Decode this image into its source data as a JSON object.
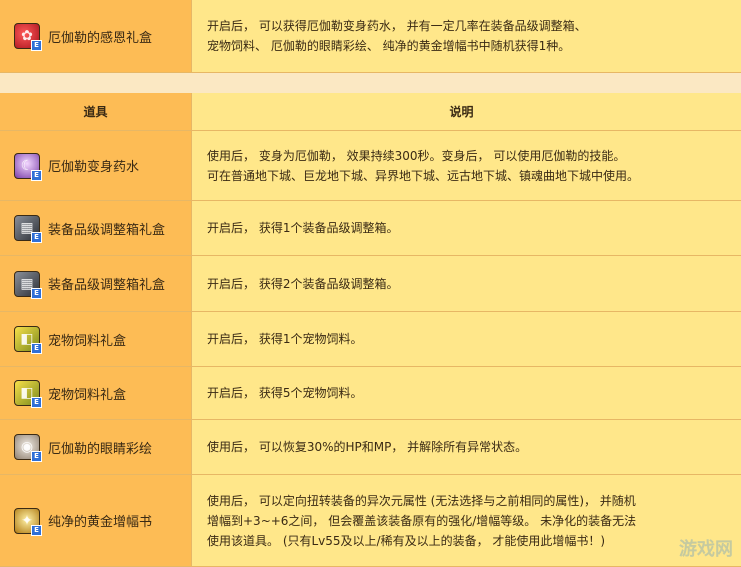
{
  "top_item": {
    "name": "厄伽勒的感恩礼盒",
    "icon": "gift-box-icon",
    "desc": [
      "开启后， 可以获得厄伽勒变身药水， 并有一定几率在装备品级调整箱、",
      "宠物饲料、 厄伽勒的眼睛彩绘、 纯净的黄金增幅书中随机获得1种。"
    ]
  },
  "header": {
    "item_col": "道具",
    "desc_col": "说明"
  },
  "items": [
    {
      "name": "厄伽勒变身药水",
      "icon": "potion-icon",
      "desc": [
        "使用后， 变身为厄伽勒， 效果持续300秒。变身后， 可以使用厄伽勒的技能。",
        "可在普通地下城、巨龙地下城、异界地下城、远古地下城、镇魂曲地下城中使用。"
      ]
    },
    {
      "name": "装备品级调整箱礼盒",
      "icon": "equipment-box-icon",
      "desc": [
        "开启后， 获得1个装备品级调整箱。"
      ]
    },
    {
      "name": "装备品级调整箱礼盒",
      "icon": "equipment-box-icon",
      "desc": [
        "开启后， 获得2个装备品级调整箱。"
      ]
    },
    {
      "name": "宠物饲料礼盒",
      "icon": "pet-feed-icon",
      "desc": [
        "开启后， 获得1个宠物饲料。"
      ]
    },
    {
      "name": "宠物饲料礼盒",
      "icon": "pet-feed-icon",
      "desc": [
        "开启后， 获得5个宠物饲料。"
      ]
    },
    {
      "name": "厄伽勒的眼睛彩绘",
      "icon": "eye-paint-icon",
      "desc": [
        "使用后， 可以恢复30%的HP和MP， 并解除所有异常状态。"
      ]
    },
    {
      "name": "纯净的黄金增幅书",
      "icon": "golden-scroll-icon",
      "desc": [
        "使用后， 可以定向扭转装备的异次元属性 (无法选择与之前相同的属性)， 并随机",
        "增幅到+3~+6之间， 但会覆盖该装备原有的强化/增幅等级。 未净化的装备无法",
        "使用该道具。 (只有Lv55及以上/稀有及以上的装备， 才能使用此增幅书！)"
      ]
    }
  ],
  "badge": "E",
  "watermark": "游戏网"
}
